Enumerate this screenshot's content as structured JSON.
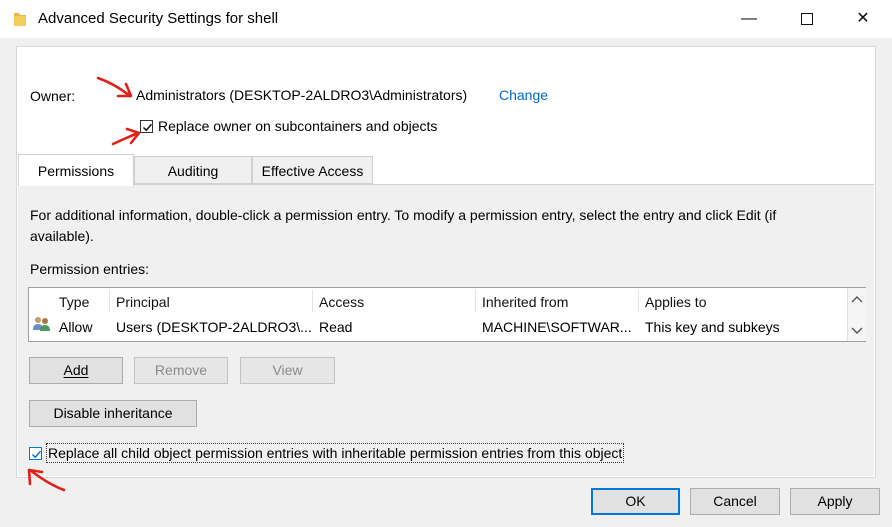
{
  "window": {
    "title": "Advanced Security Settings for shell",
    "minimize_glyph": "—",
    "maximize_glyph": "☐",
    "close_glyph": "✕"
  },
  "owner": {
    "label": "Owner:",
    "value": "Administrators (DESKTOP-2ALDRO3\\Administrators)",
    "change_link": "Change",
    "replace_checkbox_label": "Replace owner on subcontainers and objects",
    "replace_checked": true
  },
  "tabs": [
    {
      "label": "Permissions",
      "active": true
    },
    {
      "label": "Auditing",
      "active": false
    },
    {
      "label": "Effective Access",
      "active": false
    }
  ],
  "permissions": {
    "info_line1": "For additional information, double-click a permission entry. To modify a permission entry, select the entry and click Edit (if",
    "info_line2": "available).",
    "entries_label": "Permission entries:",
    "columns": [
      "Type",
      "Principal",
      "Access",
      "Inherited from",
      "Applies to"
    ],
    "rows": [
      {
        "type": "Allow",
        "principal": "Users (DESKTOP-2ALDRO3\\...",
        "access": "Read",
        "inherited_from": "MACHINE\\SOFTWAR...",
        "applies_to": "This key and subkeys",
        "icon": "users-icon"
      }
    ],
    "buttons": {
      "add": "Add",
      "remove": "Remove",
      "view": "View",
      "disable_inheritance": "Disable inheritance"
    },
    "replace_child_label": "Replace all child object permission entries with inheritable permission entries from this object",
    "replace_child_checked": true
  },
  "footer": {
    "ok": "OK",
    "cancel": "Cancel",
    "apply": "Apply"
  },
  "colors": {
    "link": "#0066cc",
    "annotation": "#e0201b",
    "focus": "#0078d7"
  }
}
